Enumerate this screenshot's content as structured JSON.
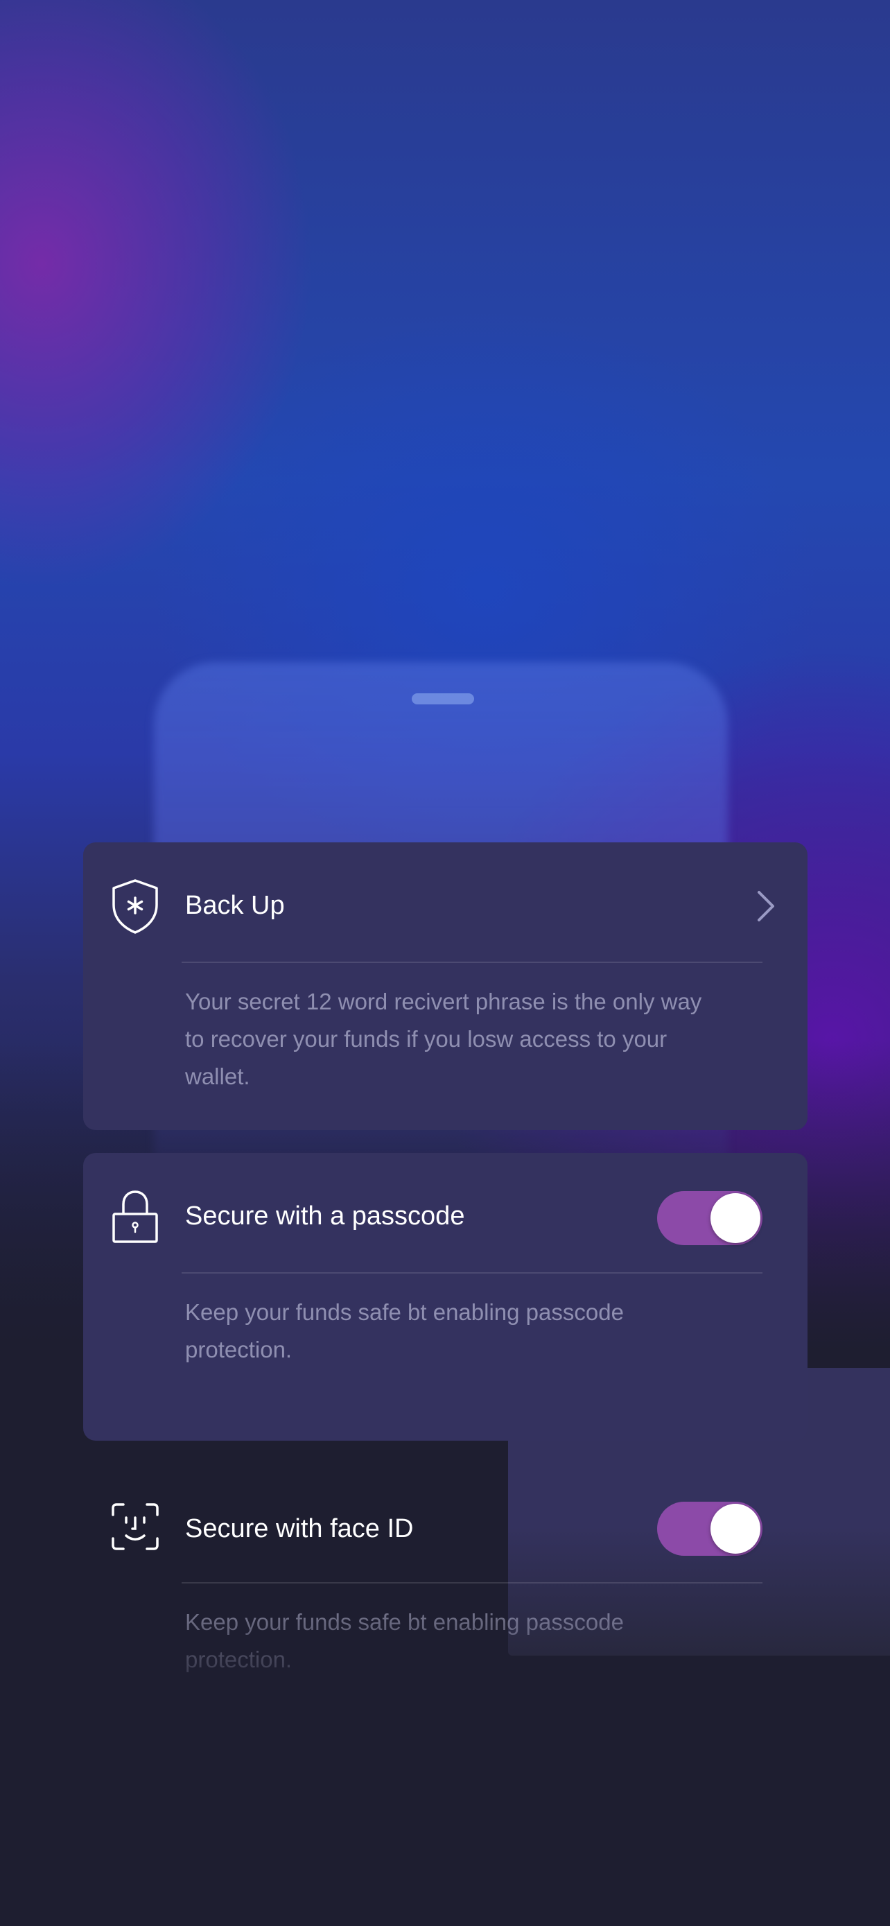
{
  "colors": {
    "card_bg": "#34325f",
    "toggle_on": "#8c4aa8",
    "page_bg": "#1e1e30"
  },
  "backup": {
    "icon": "shield-asterisk-icon",
    "title": "Back Up",
    "description": "Your secret 12 word recivert phrase is the only way to recover your funds if you losw access to your wallet.",
    "chevron_icon": "chevron-right-icon"
  },
  "passcode": {
    "icon": "padlock-icon",
    "title": "Secure with a passcode",
    "description": "Keep your funds safe bt enabling passcode protection.",
    "toggle_on": true
  },
  "faceid": {
    "icon": "face-id-icon",
    "title": "Secure with face ID",
    "description": "Keep your funds safe bt enabling passcode protection.",
    "toggle_on": true
  }
}
